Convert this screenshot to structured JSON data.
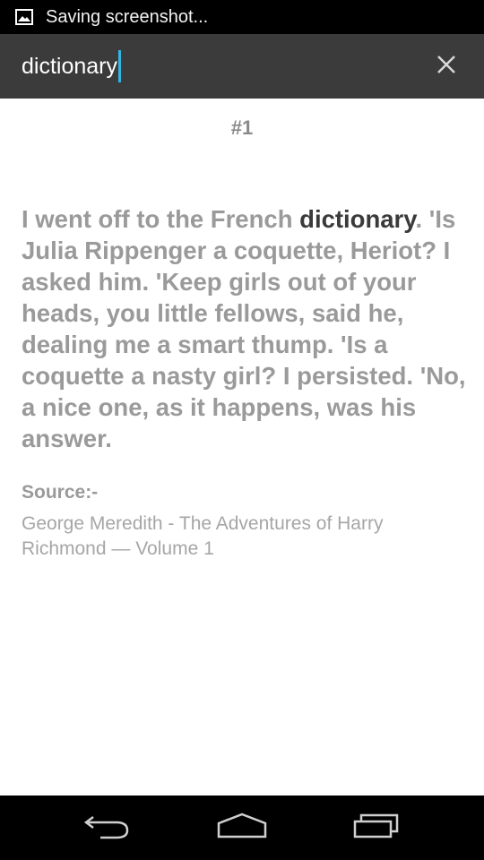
{
  "status_bar": {
    "text": "Saving screenshot...",
    "icon": "image-icon"
  },
  "search": {
    "query": "dictionary",
    "clear_icon": "close-icon"
  },
  "result": {
    "number": "#1",
    "text_before": "I went off to the French ",
    "highlight": "dictionary",
    "text_after": ". 'Is Julia Rippenger a coquette, Heriot? I asked him. 'Keep girls out of your heads, you little fellows, said he, dealing me a smart thump. 'Is a coquette a nasty girl? I persisted. 'No, a nice one, as it happens, was his answer.",
    "source_label": "Source:-",
    "source": "George Meredith - The Adventures of Harry Richmond — Volume 1"
  },
  "nav_bar": {
    "back_icon": "back-icon",
    "home_icon": "home-icon",
    "recents_icon": "recents-icon"
  },
  "colors": {
    "search_bg": "#3b3b3b",
    "cursor": "#33b5e5",
    "highlight_text": "#3a3a3a",
    "body_text": "#9a9a9a"
  }
}
